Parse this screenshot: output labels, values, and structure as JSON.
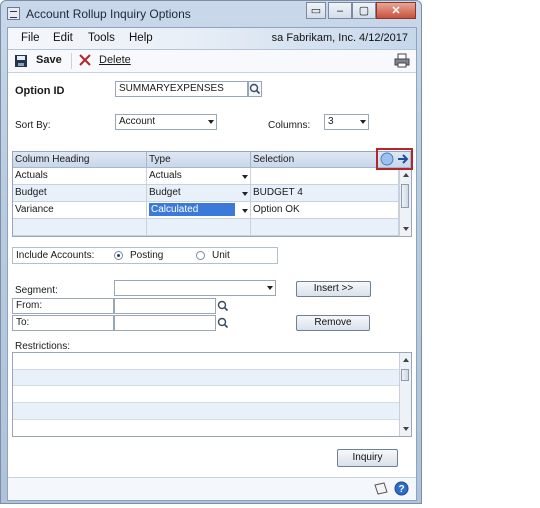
{
  "window": {
    "title": "Account Rollup Inquiry Options"
  },
  "menu": {
    "items": [
      "File",
      "Edit",
      "Tools",
      "Help"
    ],
    "company": "sa  Fabrikam, Inc.  4/12/2017"
  },
  "toolbar": {
    "save_label": "Save",
    "delete_label": "Delete"
  },
  "form": {
    "option_id_label": "Option ID",
    "option_id_value": "SUMMARYEXPENSES",
    "sort_by_label": "Sort By:",
    "sort_by_value": "Account",
    "columns_label": "Columns:",
    "columns_value": "3"
  },
  "grid": {
    "headers": [
      "Column Heading",
      "Type",
      "Selection"
    ],
    "rows": [
      {
        "heading": "Actuals",
        "type": "Actuals",
        "selection": ""
      },
      {
        "heading": "Budget",
        "type": "Budget",
        "selection": "BUDGET 4"
      },
      {
        "heading": "Variance",
        "type": "Calculated",
        "selection": "Option OK"
      }
    ],
    "selected_row": 2
  },
  "include_accounts": {
    "label": "Include Accounts:",
    "options": [
      "Posting",
      "Unit"
    ],
    "selected": "Posting"
  },
  "segment": {
    "segment_label": "Segment:",
    "from_label": "From:",
    "to_label": "To:",
    "insert_label": "Insert >>",
    "remove_label": "Remove"
  },
  "restrictions": {
    "label": "Restrictions:"
  },
  "buttons": {
    "inquiry_label": "Inquiry"
  },
  "colors": {
    "selection_highlight": "#3b7ad9",
    "accent_border": "#b3262c",
    "header_band": "#c8d8ec"
  }
}
